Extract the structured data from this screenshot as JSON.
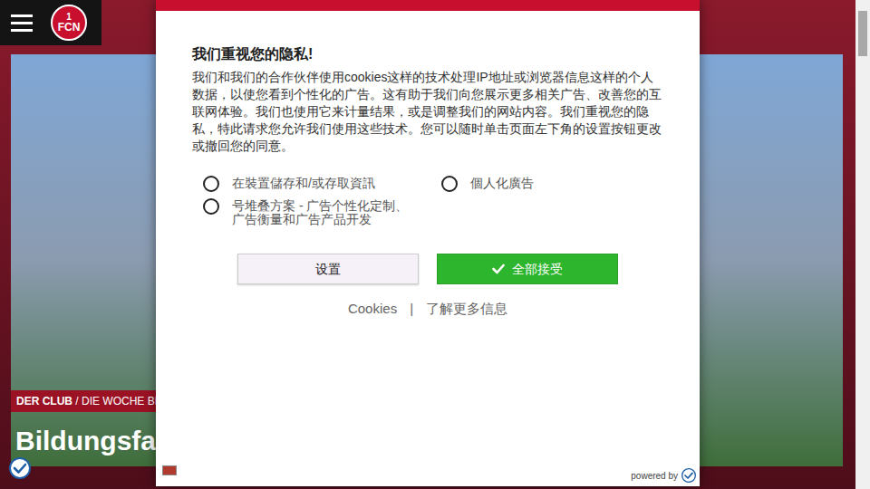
{
  "header": {
    "logo": {
      "top": "1",
      "bottom": "FCN"
    }
  },
  "hero": {
    "kicker_section": "DER CLUB",
    "kicker_rest": " / DIE WOCHE BEI",
    "title": "Bildungsfal"
  },
  "consent": {
    "title": "我们重视您的隐私!",
    "text": "我们和我们的合作伙伴使用cookies这样的技术处理IP地址或浏览器信息这样的个人数据，以使您看到个性化的广告。这有助于我们向您展示更多相关广告、改善您的互联网体验。我们也使用它来计量结果，或是调整我们的网站内容。我们重视您的隐私，特此请求您允许我们使用这些技术。您可以随时单击页面左下角的设置按钮更改或撤回您的同意。",
    "options": [
      {
        "label": "在裝置儲存和/或存取資訊",
        "checked": false
      },
      {
        "label": "個人化廣告",
        "checked": false
      },
      {
        "label": "号堆叠方案 - 广告个性化定制、广告衡量和广告产品开发",
        "checked": false
      }
    ],
    "buttons": [
      {
        "label": "设置",
        "kind": "secondary"
      },
      {
        "label": "全部接受",
        "kind": "primary"
      }
    ],
    "links": [
      "Cookies",
      "了解更多信息"
    ],
    "separator": "|",
    "powered_by": "powered by"
  }
}
